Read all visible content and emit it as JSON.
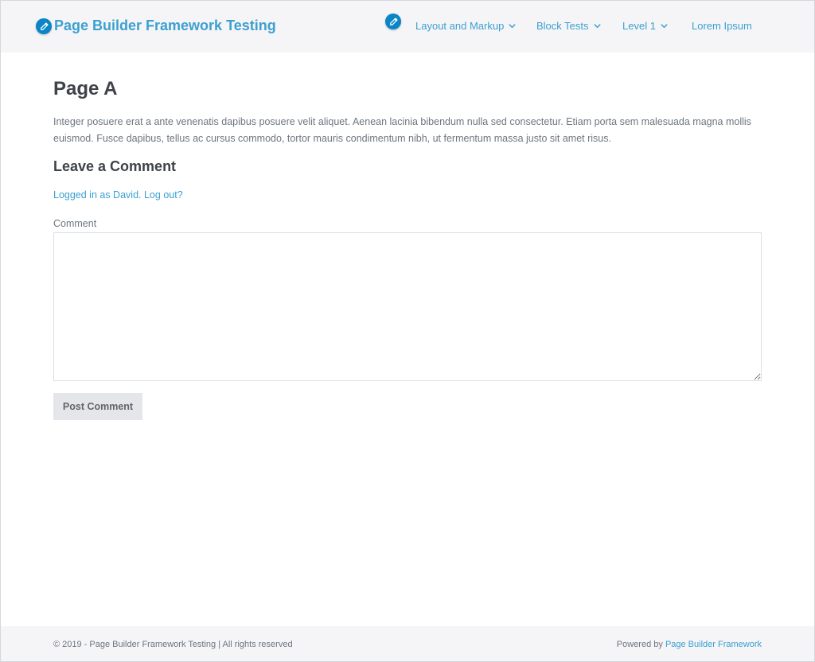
{
  "header": {
    "site_title": "Page Builder Framework Testing",
    "nav": [
      {
        "label": "Layout and Markup",
        "has_dropdown": true
      },
      {
        "label": "Block Tests",
        "has_dropdown": true
      },
      {
        "label": "Level 1",
        "has_dropdown": true
      },
      {
        "label": "Lorem Ipsum",
        "has_dropdown": false
      }
    ],
    "edit_icon": "pencil-icon",
    "dropdown_icon": "chevron-down-icon"
  },
  "main": {
    "page_title": "Page A",
    "intro": "Integer posuere erat a ante venenatis dapibus posuere velit aliquet. Aenean lacinia bibendum nulla sed consectetur. Etiam porta sem malesuada magna mollis euismod. Fusce dapibus, tellus ac cursus commodo, tortor mauris condimentum nibh, ut fermentum massa justo sit amet risus.",
    "comments_heading": "Leave a Comment",
    "logged_in_link": "Logged in as David",
    "logged_in_sep": ". ",
    "logout_link": "Log out?",
    "comment_label": "Comment",
    "comment_value": "",
    "post_button": "Post Comment"
  },
  "footer": {
    "copyright": "© 2019 - Page Builder Framework Testing | All rights reserved",
    "powered_prefix": "Powered by ",
    "powered_link": "Page Builder Framework"
  },
  "colors": {
    "accent": "#3ba0d0",
    "edit_badge": "#0a86c7",
    "heading": "#3e4349",
    "text": "#6d7680",
    "header_bg": "#f5f5f7",
    "button_bg": "#e5e6ea"
  }
}
